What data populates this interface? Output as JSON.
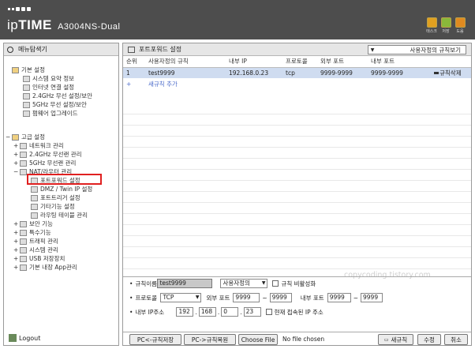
{
  "header": {
    "brand_prefix": "ip",
    "brand_main": "TIME",
    "model": "A3004NS-Dual",
    "icons": [
      {
        "name": "tasks-icon",
        "label": "태스크",
        "color": "#e0a020"
      },
      {
        "name": "save-icon",
        "label": "저장",
        "color": "#8ab83a"
      },
      {
        "name": "help-icon",
        "label": "도움",
        "color": "#e08a20"
      }
    ]
  },
  "nav": {
    "title": "메뉴탐색기",
    "basic": {
      "title": "기본 설정",
      "items": [
        "시스템 요약 정보",
        "인터넷 연결 설정",
        "2.4GHz 무선 설정/보안",
        "5GHz 무선 설정/보안",
        "펌웨어 업그레이드"
      ]
    },
    "advanced": {
      "title": "고급 설정",
      "items": [
        "네트워크 관리",
        "2.4GHz 무선랜 관리",
        "5GHz 무선랜 관리",
        "NAT/라우터 관리"
      ],
      "nat_items": [
        "포트포워드 설정",
        "DMZ / Twin IP 설정",
        "포트트리거 설정",
        "기타기능 설정",
        "라우팅 테이블 관리"
      ],
      "other_items": [
        "보안 기능",
        "특수기능",
        "트래픽 관리",
        "시스템 관리",
        "USB 저장장치",
        "기본 내장 App관리"
      ]
    },
    "logout": "Logout"
  },
  "main": {
    "title": "포트포워드 설정",
    "view_select": "사용자정의 규칙보기",
    "columns": [
      "순위",
      "사용자정의 규칙",
      "내부 IP",
      "프로토콜",
      "외부 포트",
      "내부 포트"
    ],
    "rows": [
      {
        "rank": "1",
        "name": "test9999",
        "ip": "192.168.0.23",
        "protocol": "tcp",
        "ext_port": "9999-9999",
        "int_port": "9999-9999",
        "delete": "규칙삭제"
      }
    ],
    "add_rule": "새규칙 추가",
    "watermark": "copycoding.tistory.com"
  },
  "form": {
    "rule_name_label": "규칙이름",
    "rule_name_value": "test9999",
    "rule_type": "사용자정의",
    "disable_label": "규칙 비활성화",
    "protocol_label": "프로토콜",
    "protocol_value": "TCP",
    "ext_port_label": "외부 포트",
    "ext_port_from": "9999",
    "ext_port_to": "9999",
    "int_port_label": "내부 포트",
    "int_port_from": "9999",
    "int_port_to": "9999",
    "ip_label": "내부 IP주소",
    "ip1": "192",
    "ip2": "168",
    "ip3": "0",
    "ip4": "23",
    "current_ip_label": "현재 접속된 IP 주소",
    "tilde": "~",
    "dot": "."
  },
  "buttons": {
    "pc_save": "PC<-규칙저장",
    "pc_restore": "PC->규칙복원",
    "choose_file": "Choose File",
    "no_file": "No file chosen",
    "new_rule": "새규칙",
    "modify": "수정",
    "cancel": "취소"
  }
}
